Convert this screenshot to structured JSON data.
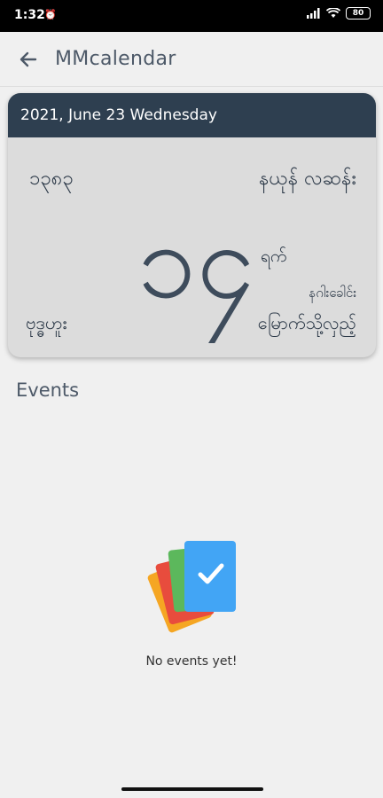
{
  "status_bar": {
    "time": "1:32",
    "notification_icon": "alarm-icon",
    "battery": "80"
  },
  "app_bar": {
    "back_icon": "arrow-back-icon",
    "title": "MMcalendar"
  },
  "date_card": {
    "header_date": "2021, June 23 Wednesday",
    "mm_year": "၁၃၈၃",
    "mm_month": "နယုန် လဆန်း",
    "mm_day": "၁၄",
    "mm_day_unit": "ရက်",
    "nagahle": "နဂါးခေါင်း",
    "mm_weekday": "ဗုဒ္ဓဟူး",
    "astro": "မြောက်သို့လှည့်",
    "colors": {
      "header": "#2e3f50",
      "card": "#dcdcdc",
      "text": "#2c3948"
    }
  },
  "events": {
    "heading": "Events",
    "empty_message": "No events yet!"
  }
}
